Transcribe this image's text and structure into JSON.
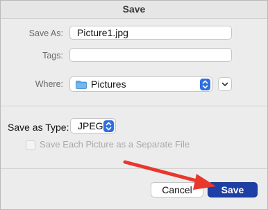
{
  "dialog": {
    "title": "Save",
    "save_as_label": "Save As:",
    "save_as_value": "Picture1.jpg",
    "tags_label": "Tags:",
    "tags_value": "",
    "where_label": "Where:",
    "where_value": "Pictures",
    "where_icon": "folder-icon",
    "save_as_type_label": "Save as Type:",
    "save_as_type_value": "JPEG",
    "checkbox_label": "Save Each Picture as a Separate File",
    "checkbox_checked": false,
    "checkbox_enabled": false,
    "cancel_label": "Cancel",
    "save_label": "Save"
  },
  "colors": {
    "accent": "#1d3fa6",
    "stepper": "#2f6fe0",
    "arrow": "#e8372c"
  }
}
